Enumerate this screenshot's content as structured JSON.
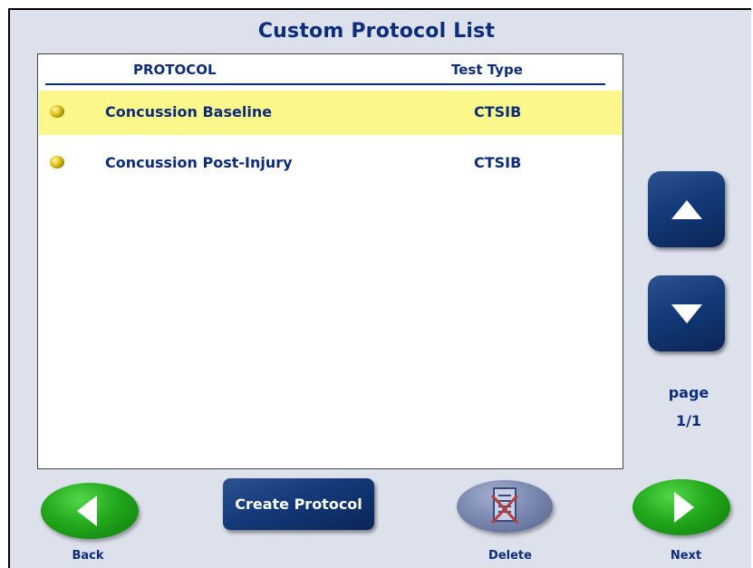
{
  "title": "Custom Protocol List",
  "columns": {
    "protocol": "PROTOCOL",
    "test_type": "Test Type"
  },
  "rows": [
    {
      "name": "Concussion Baseline",
      "type": "CTSIB",
      "selected": true
    },
    {
      "name": "Concussion Post-Injury",
      "type": "CTSIB",
      "selected": false
    }
  ],
  "pagination": {
    "label": "page",
    "value": "1/1"
  },
  "buttons": {
    "scroll_up_icon": "triangle-up-icon",
    "scroll_down_icon": "triangle-down-icon",
    "create": "Create Protocol",
    "back": "Back",
    "delete": "Delete",
    "next": "Next"
  },
  "colors": {
    "background": "#dde1ec",
    "text": "#0d2c7a",
    "selected_row": "#fbf78a",
    "nav_button": "#133a78",
    "green_button": "#22a81c",
    "disabled_button": "#7885ad"
  }
}
